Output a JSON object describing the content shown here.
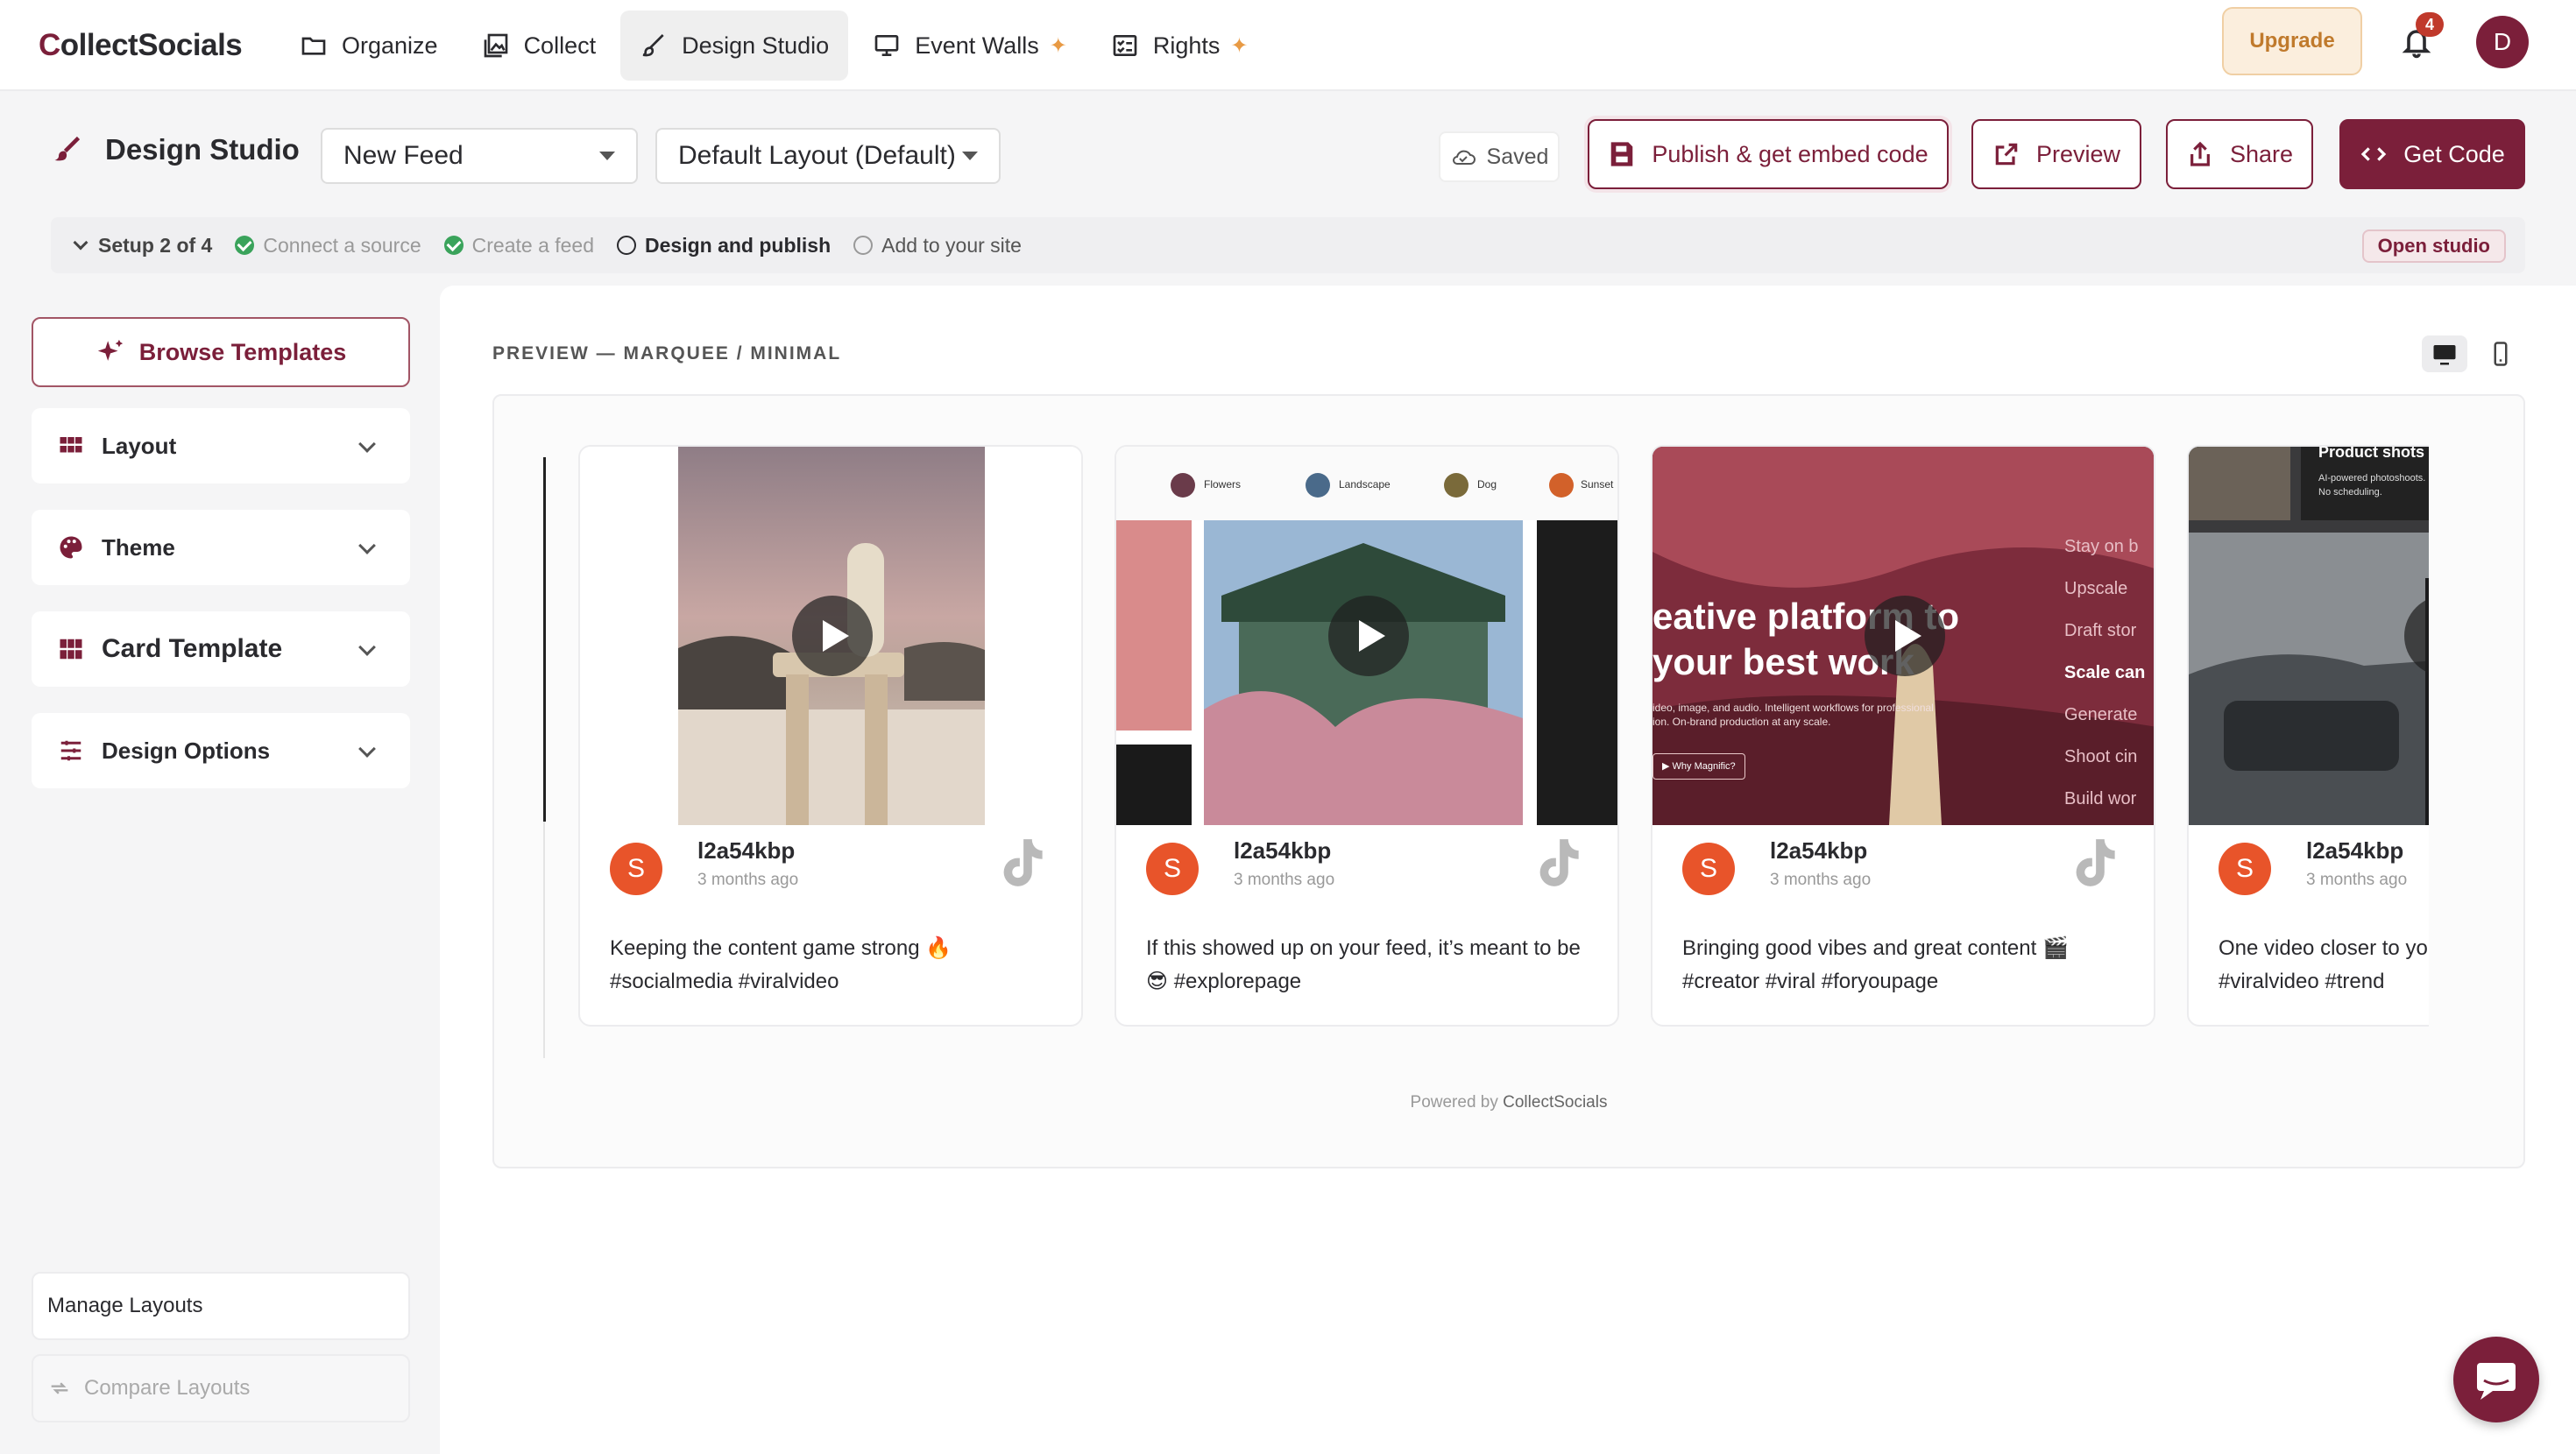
{
  "app": {
    "logo_first": "C",
    "logo_rest": "ollectSocials",
    "colors": {
      "brand": "#7b1f3a",
      "accent": "#e89a44",
      "badge": "#c0392b"
    }
  },
  "nav": {
    "items": [
      {
        "label": "Organize",
        "icon": "folder-icon"
      },
      {
        "label": "Collect",
        "icon": "gallery-icon"
      },
      {
        "label": "Design Studio",
        "icon": "brush-icon",
        "active": true
      },
      {
        "label": "Event Walls",
        "icon": "monitor-icon",
        "sparkle": "✦"
      },
      {
        "label": "Rights",
        "icon": "checklist-icon",
        "sparkle": "✦"
      }
    ],
    "upgrade_label": "Upgrade",
    "notifications_count": "4",
    "avatar_initial": "D"
  },
  "studio": {
    "title": "Design Studio",
    "feed_select": "New Feed",
    "layout_select": "Default Layout (Default)",
    "saved_label": "Saved",
    "publish_label": "Publish & get embed code",
    "preview_label": "Preview",
    "share_label": "Share",
    "get_code_label": "Get Code"
  },
  "setup": {
    "head": "Setup 2 of 4",
    "steps": [
      {
        "label": "Connect a source",
        "state": "done"
      },
      {
        "label": "Create a feed",
        "state": "done"
      },
      {
        "label": "Design and publish",
        "state": "current"
      },
      {
        "label": "Add to your site",
        "state": "todo"
      }
    ],
    "open_studio": "Open studio"
  },
  "sidebar": {
    "browse_templates": "Browse Templates",
    "sections": [
      {
        "label": "Layout",
        "icon": "grid-icon"
      },
      {
        "label": "Theme",
        "icon": "palette-icon"
      },
      {
        "label": "Card Template",
        "icon": "grid-icon"
      },
      {
        "label": "Design Options",
        "icon": "sliders-icon"
      }
    ],
    "manage_layouts": "Manage Layouts",
    "compare_layouts": "Compare Layouts"
  },
  "preview": {
    "label": "PREVIEW — MARQUEE / MINIMAL",
    "powered_prefix": "Powered by",
    "powered_brand": "CollectSocials",
    "posts": [
      {
        "initial": "S",
        "user": "l2a54kbp",
        "time": "3 months ago",
        "text": "Keeping the content game strong 🔥 #socialmedia #viralvideo"
      },
      {
        "initial": "S",
        "user": "l2a54kbp",
        "time": "3 months ago",
        "text": "If this showed up on your feed, it’s meant to be 😎 #explorepage",
        "chips": [
          "Flowers",
          "Landscape",
          "Dog",
          "Sunset"
        ]
      },
      {
        "initial": "S",
        "user": "l2a54kbp",
        "time": "3 months ago",
        "text": "Bringing good vibes and great content 🎬 #creator #viral #foryoupage",
        "overlay_main": "eative platform to\nyour best work",
        "overlay_small": "ideo, image, and audio. Intelligent workflows for professional\nion. On-brand production at any scale.",
        "overlay_btn": "▶ Why Magnific?",
        "overlay_list": [
          "Stay on b",
          "Upscale",
          "Draft stor",
          "Scale can",
          "Generate",
          "Shoot cin",
          "Build wor"
        ]
      },
      {
        "initial": "S",
        "user": "l2a54kbp",
        "time": "3 months ago",
        "text": "One video closer to your ✨ #viralvideo #trend",
        "overlay_title": "Product shots",
        "overlay_small": "AI-powered photoshoots. No s\nNo scheduling."
      }
    ]
  }
}
